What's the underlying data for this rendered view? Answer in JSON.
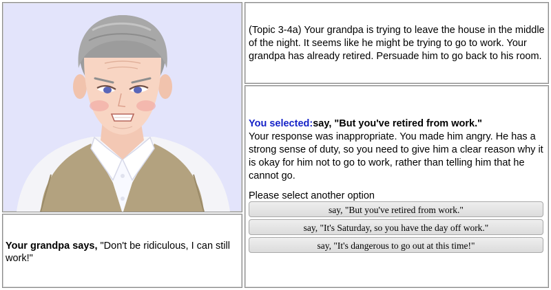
{
  "speech": {
    "speaker": "Your grandpa says,",
    "quote": "\"Don't be ridiculous, I can still work!\""
  },
  "topic": {
    "text": "(Topic 3-4a) Your grandpa is trying to leave the house in the middle of the night. It seems like he might be trying to go to work. Your grandpa has already retired. Persuade him to go back to his room."
  },
  "feedback": {
    "selected_label": "You selected:",
    "selected_choice": "say, \"But you've retired from work.\"",
    "response": "Your response was inappropriate. You made him angry. He has a strong sense of duty, so you need to give him a clear reason why it is okay for him not to go to work, rather than telling him that he cannot go.",
    "prompt": "Please select another option",
    "options": [
      "say, \"But you've retired from work.\"",
      "say, \"It's Saturday, so you have the day off work.\"",
      "say, \"It's dangerous to go out at this time!\""
    ]
  },
  "colors": {
    "avatar_bg": "#e3e4fb",
    "selected_label": "#1522c8"
  }
}
